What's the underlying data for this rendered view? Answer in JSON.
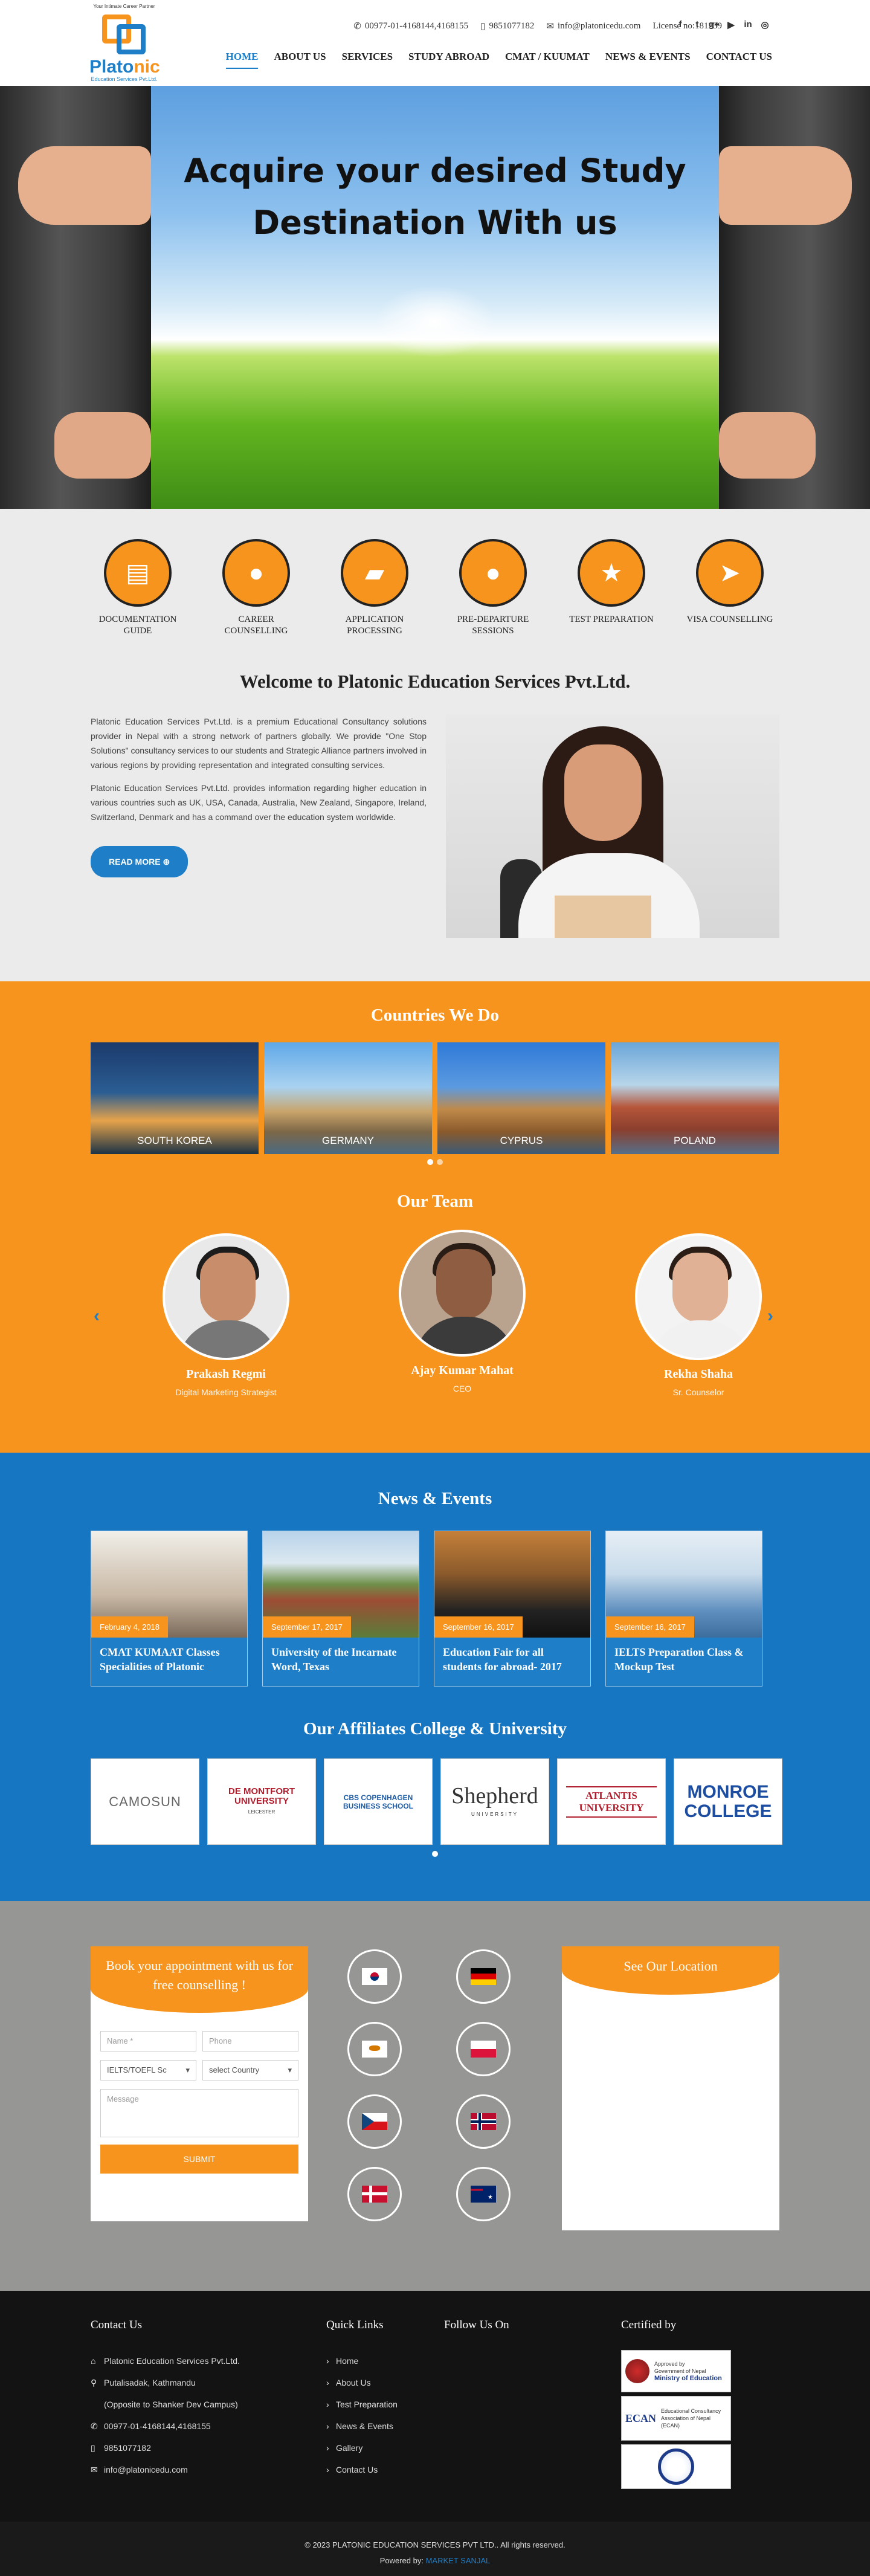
{
  "header": {
    "logo_tagline": "Your Intimate Career Partner",
    "logo_name_a": "Plato",
    "logo_name_b": "nic",
    "logo_sub": "Education Services Pvt.Ltd.",
    "phone": "00977-01-4168144,4168155",
    "mobile": "9851077182",
    "email": "info@platonicedu.com",
    "license": "License no:181239",
    "social": [
      "f",
      "t",
      "g+",
      "yt",
      "in",
      "ig"
    ],
    "nav": [
      "HOME",
      "ABOUT US",
      "SERVICES",
      "STUDY ABROAD",
      "CMAT / KUUMAT",
      "NEWS & EVENTS",
      "CONTACT US"
    ]
  },
  "hero": {
    "line1": "Acquire your desired Study",
    "line2": "Destination With us"
  },
  "services": [
    {
      "icon": "book-icon",
      "glyph": "▤",
      "label": "DOCUMENTATION GUIDE"
    },
    {
      "icon": "chat-icon",
      "glyph": "●",
      "label": "CAREER COUNSELLING"
    },
    {
      "icon": "folder-icon",
      "glyph": "▰",
      "label": "APPLICATION PROCESSING"
    },
    {
      "icon": "comment-icon",
      "glyph": "●",
      "label": "PRE-DEPARTURE SESSIONS"
    },
    {
      "icon": "star-icon",
      "glyph": "★",
      "label": "TEST PREPARATION"
    },
    {
      "icon": "send-icon",
      "glyph": "➤",
      "label": "VISA COUNSELLING"
    }
  ],
  "welcome": {
    "title": "Welcome to Platonic Education Services Pvt.Ltd.",
    "p1": "Platonic Education Services Pvt.Ltd. is a premium Educational Consultancy solutions provider in Nepal with a strong network of partners globally. We provide \"One Stop Solutions\" consultancy services to our students and Strategic Alliance partners involved in various regions by providing representation and integrated consulting services.",
    "p2": "Platonic Education Services Pvt.Ltd. provides information regarding higher education in various countries such as UK, USA, Canada, Australia, New Zealand, Singapore, Ireland, Switzerland, Denmark and has a command over the education system worldwide.",
    "readmore": "READ MORE ⊕"
  },
  "countries": {
    "title": "Countries We Do",
    "items": [
      "SOUTH KOREA",
      "GERMANY",
      "CYPRUS",
      "POLAND"
    ]
  },
  "team": {
    "title": "Our Team",
    "members": [
      {
        "name": "Prakash Regmi",
        "role": "Digital Marketing Strategist"
      },
      {
        "name": "Ajay Kumar Mahat",
        "role": "CEO"
      },
      {
        "name": "Rekha Shaha",
        "role": "Sr. Counselor"
      }
    ]
  },
  "news": {
    "title": "News & Events",
    "items": [
      {
        "date": "February 4, 2018",
        "title": "CMAT KUMAAT Classes Specialities of Platonic"
      },
      {
        "date": "September 17, 2017",
        "title": "University of the Incarnate Word, Texas"
      },
      {
        "date": "September 16, 2017",
        "title": "Education Fair for all students for abroad- 2017"
      },
      {
        "date": "September 16, 2017",
        "title": "IELTS Preparation Class & Mockup Test"
      }
    ]
  },
  "affiliates": {
    "title": "Our Affiliates College & University",
    "items": [
      "CAMOSUN",
      "DE MONTFORT UNIVERSITY",
      "CBS COPENHAGEN BUSINESS SCHOOL",
      "Shepherd",
      "ATLANTIS UNIVERSITY",
      "MONROE COLLEGE"
    ],
    "logo_subs": [
      "LEICESTER",
      "UNIVERSITY"
    ]
  },
  "appointment": {
    "title": "Book your appointment with us for free counselling !",
    "name_ph": "Name *",
    "phone_ph": "Phone",
    "test_value": "IELTS/TOEFL Sc",
    "country_value": "select Country",
    "message_ph": "Message",
    "submit": "SUBMIT"
  },
  "location": {
    "title": "See Our Location"
  },
  "footer": {
    "contact_title": "Contact Us",
    "company": "Platonic Education Services Pvt.Ltd.",
    "address1": "Putalisadak, Kathmandu",
    "address2": "(Opposite to Shanker Dev Campus)",
    "phone": "00977-01-4168144,4168155",
    "mobile": "9851077182",
    "email": "info@platonicedu.com",
    "links_title": "Quick Links",
    "links": [
      "Home",
      "About Us",
      "Test Preparation",
      "News & Events",
      "Gallery",
      "Contact Us"
    ],
    "follow_title": "Follow Us On",
    "certified_title": "Certified by",
    "cert1_a": "Approved by",
    "cert1_b": "Government of Nepal",
    "cert1_c": "Ministry of Education",
    "cert2_a": "ECAN",
    "cert2_b": "Educational Consultancy Association of Nepal (ECAN)",
    "copyright": "© 2023 PLATONIC EDUCATION SERVICES PVT LTD.. All rights reserved.",
    "powered_label": "Powered by:",
    "powered_by": "MARKET SANJAL"
  },
  "colors": {
    "orange": "#f7941d",
    "blue": "#1676c2",
    "gray": "#969694",
    "dark": "#131313"
  }
}
